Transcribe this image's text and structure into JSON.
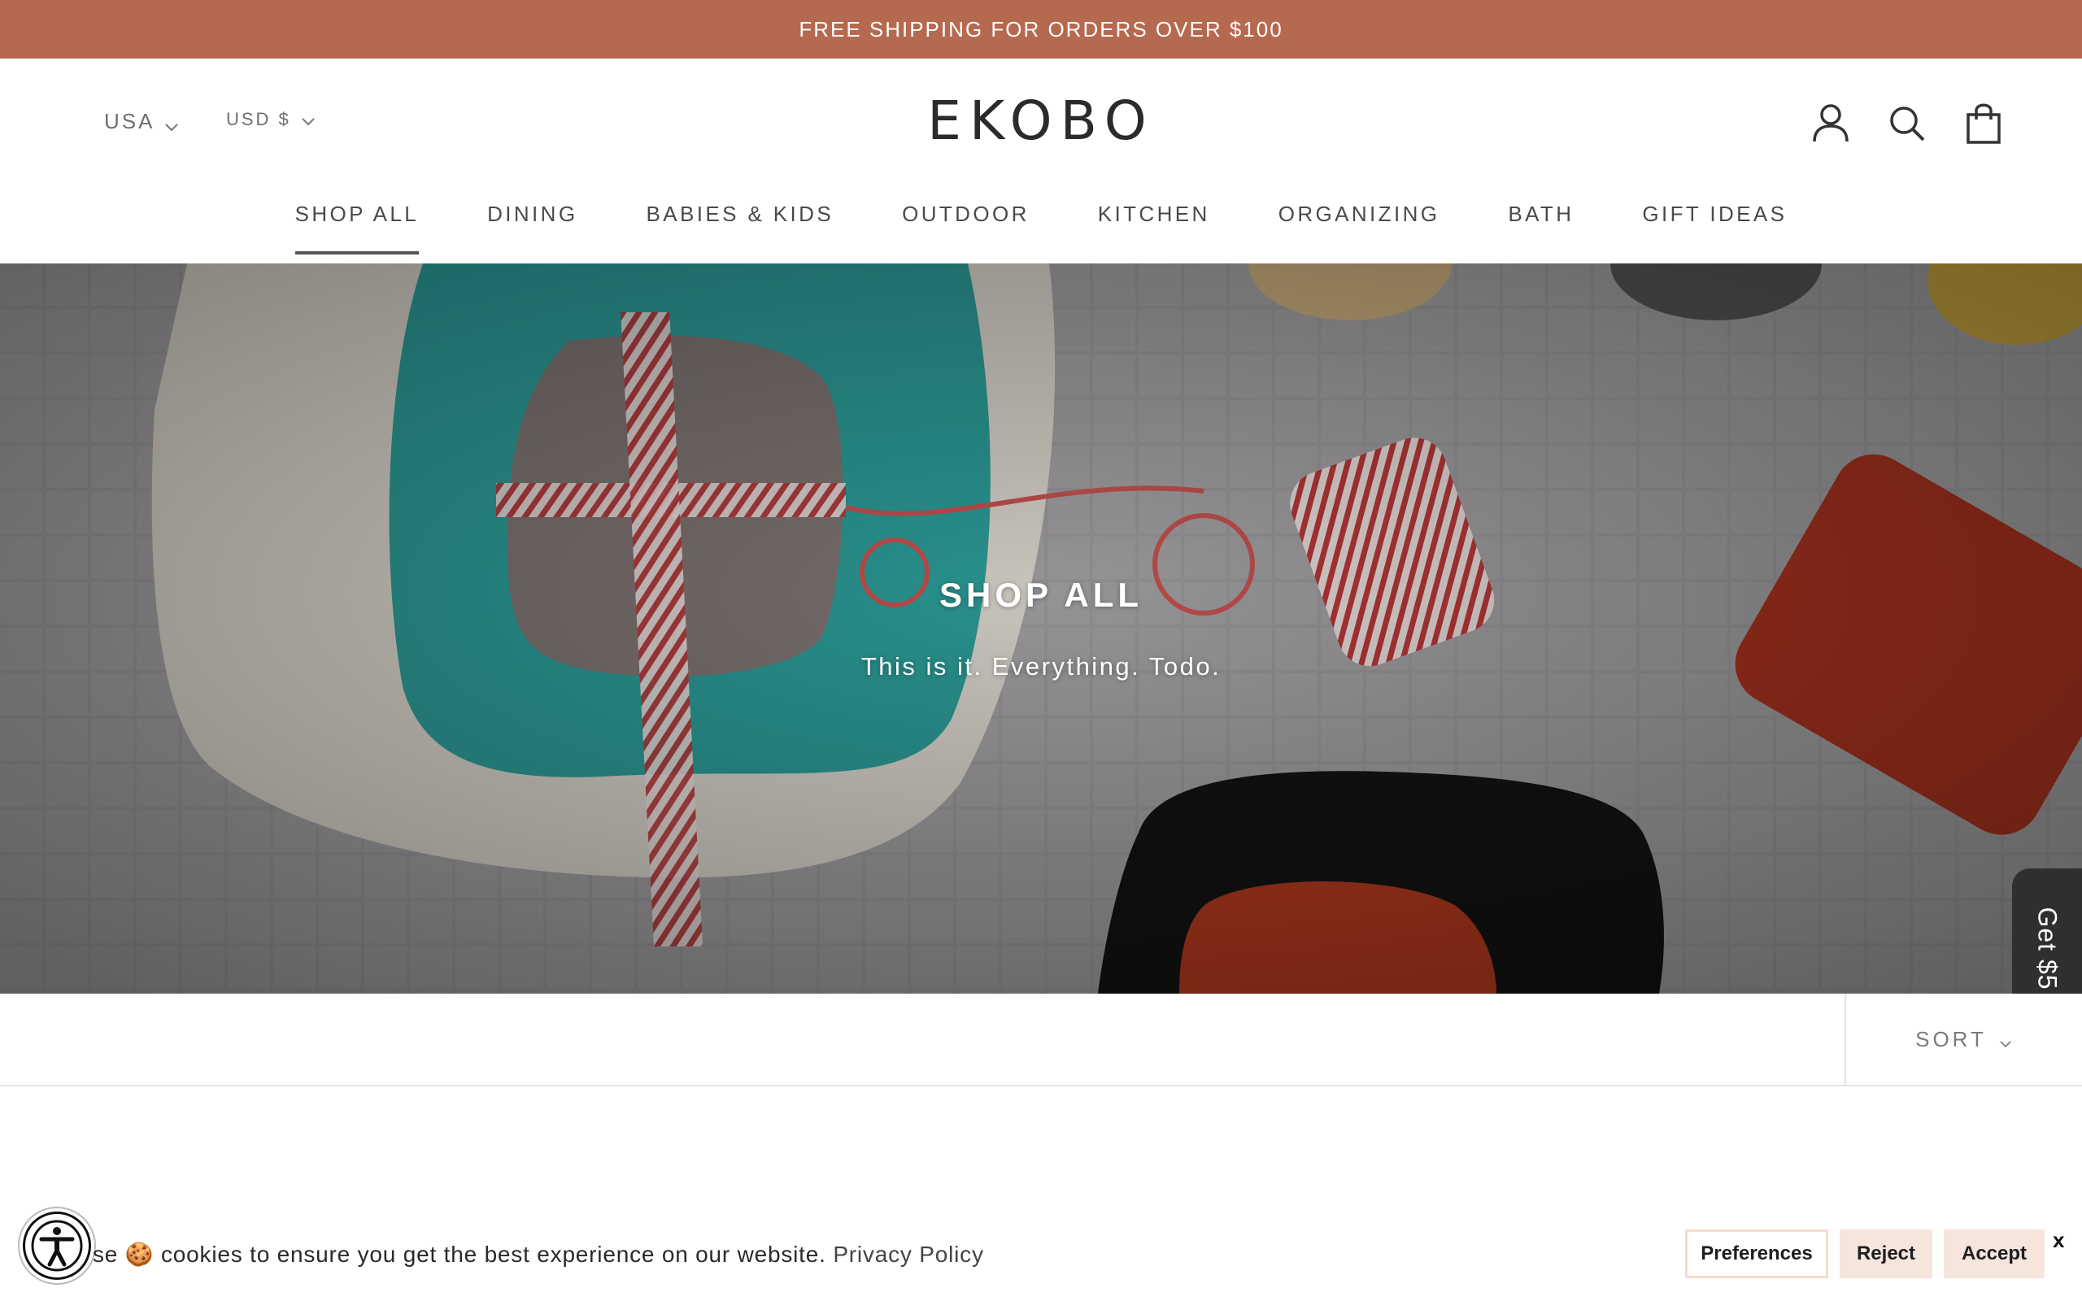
{
  "announcement": {
    "text": "FREE SHIPPING FOR ORDERS OVER $100"
  },
  "header": {
    "country": "USA",
    "currency": "USD $",
    "logo": "EKOBO",
    "icons": [
      "account-icon",
      "search-icon",
      "bag-icon"
    ]
  },
  "nav": {
    "items": [
      {
        "label": "SHOP ALL",
        "active": true
      },
      {
        "label": "DINING"
      },
      {
        "label": "BABIES & KIDS"
      },
      {
        "label": "OUTDOOR"
      },
      {
        "label": "KITCHEN"
      },
      {
        "label": "ORGANIZING"
      },
      {
        "label": "BATH"
      },
      {
        "label": "GIFT IDEAS"
      }
    ]
  },
  "hero": {
    "title": "SHOP ALL",
    "subtitle": "This is it. Everything. Todo."
  },
  "side_tab": {
    "label": "Get $5"
  },
  "toolbar": {
    "sort_label": "SORT"
  },
  "cookie": {
    "text": "se 🍪 cookies to ensure you get the best experience on our website.",
    "link": "Privacy Policy",
    "preferences": "Preferences",
    "reject": "Reject",
    "accept": "Accept",
    "close": "x"
  },
  "colors": {
    "announcement_bg": "#b5694f",
    "accent_button_bg": "#f6e5dc",
    "side_tab_bg": "#2f2f2f"
  }
}
